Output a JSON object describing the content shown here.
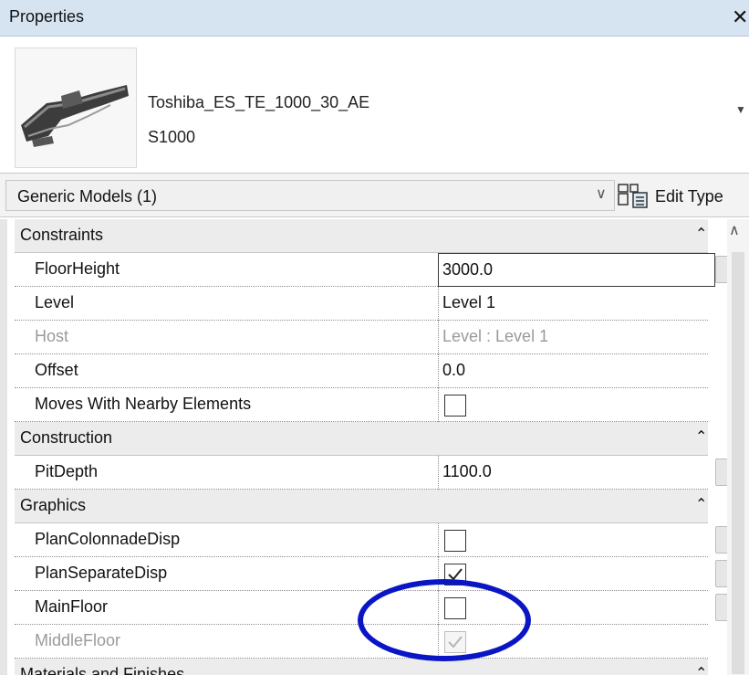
{
  "panel": {
    "title": "Properties",
    "close_glyph": "✕"
  },
  "type_selector": {
    "family": "Toshiba_ES_TE_1000_30_AE",
    "type": "S1000",
    "dropdown_glyph": "▼"
  },
  "filter": {
    "selected": "Generic Models (1)",
    "chevron_glyph": "∨",
    "edit_type_label": "Edit Type"
  },
  "categories": {
    "constraints": "Constraints",
    "construction": "Construction",
    "graphics": "Graphics",
    "materials": "Materials and Finishes",
    "collapse_glyph": "⌃"
  },
  "params": {
    "floor_height": {
      "name": "FloorHeight",
      "value": "3000.0"
    },
    "level": {
      "name": "Level",
      "value": "Level 1"
    },
    "host": {
      "name": "Host",
      "value": "Level : Level 1"
    },
    "offset": {
      "name": "Offset",
      "value": "0.0"
    },
    "moves_with": {
      "name": "Moves With Nearby Elements",
      "checked": false
    },
    "pit_depth": {
      "name": "PitDepth",
      "value": "1100.0"
    },
    "plan_colonnade": {
      "name": "PlanColonnadeDisp",
      "checked": false
    },
    "plan_separate": {
      "name": "PlanSeparateDisp",
      "checked": true
    },
    "main_floor": {
      "name": "MainFloor",
      "checked": false
    },
    "middle_floor": {
      "name": "MiddleFloor",
      "checked": true
    }
  },
  "scrollbar": {
    "up_glyph": "∧"
  },
  "colors": {
    "annotation": "#0a16c6",
    "title_bar": "#d6e4f2"
  }
}
